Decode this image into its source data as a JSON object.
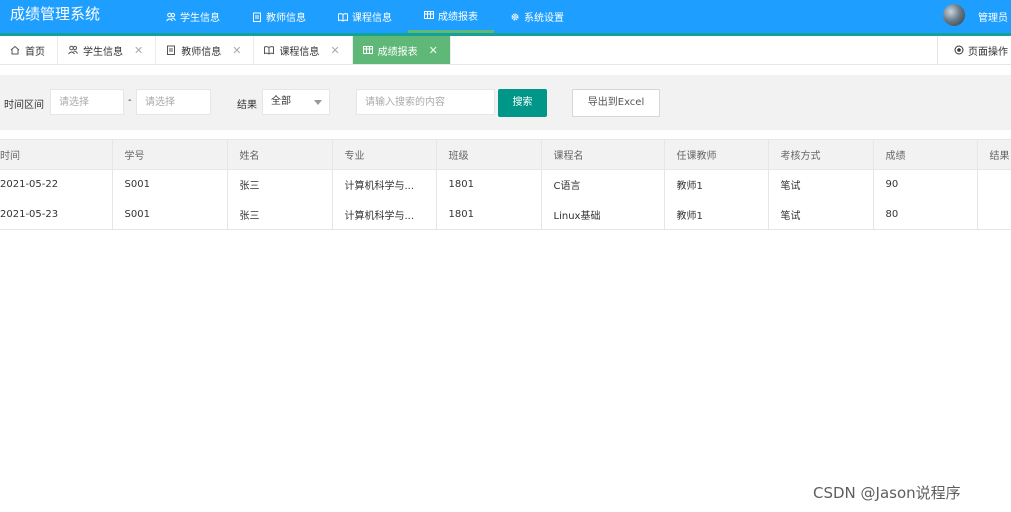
{
  "app": {
    "title": "成绩管理系统",
    "admin_label": "管理员"
  },
  "topnav": [
    {
      "label": "学生信息",
      "icon": "users-icon"
    },
    {
      "label": "教师信息",
      "icon": "clipboard-icon"
    },
    {
      "label": "课程信息",
      "icon": "book-icon"
    },
    {
      "label": "成绩报表",
      "icon": "table-icon"
    },
    {
      "label": "系统设置",
      "icon": "gear-icon"
    }
  ],
  "tabs": [
    {
      "label": "首页",
      "icon": "home-icon"
    },
    {
      "label": "学生信息",
      "icon": "users-icon"
    },
    {
      "label": "教师信息",
      "icon": "clipboard-icon"
    },
    {
      "label": "课程信息",
      "icon": "book-icon"
    },
    {
      "label": "成绩报表",
      "icon": "table-icon",
      "active": true
    }
  ],
  "page_ops_label": "页面操作",
  "filter": {
    "time_label": "时间区间",
    "start_placeholder": "请选择",
    "separator": "-",
    "end_placeholder": "请选择",
    "result_label": "结果",
    "result_value": "全部",
    "search_placeholder": "请输入搜索的内容",
    "search_button": "搜索",
    "export_button": "导出到Excel"
  },
  "table": {
    "headers": [
      "时间",
      "学号",
      "姓名",
      "专业",
      "班级",
      "课程名",
      "任课教师",
      "考核方式",
      "成绩",
      "结果"
    ],
    "rows": [
      [
        "2021-05-22",
        "S001",
        "张三",
        "计算机科学与...",
        "1801",
        "C语言",
        "教师1",
        "笔试",
        "90",
        ""
      ],
      [
        "2021-05-23",
        "S001",
        "张三",
        "计算机科学与...",
        "1801",
        "Linux基础",
        "教师1",
        "笔试",
        "80",
        ""
      ]
    ]
  },
  "watermark": "CSDN @Jason说程序",
  "colors": {
    "topbar": "#1e9fff",
    "active_tab": "#5fb878",
    "search_button": "#009688"
  }
}
